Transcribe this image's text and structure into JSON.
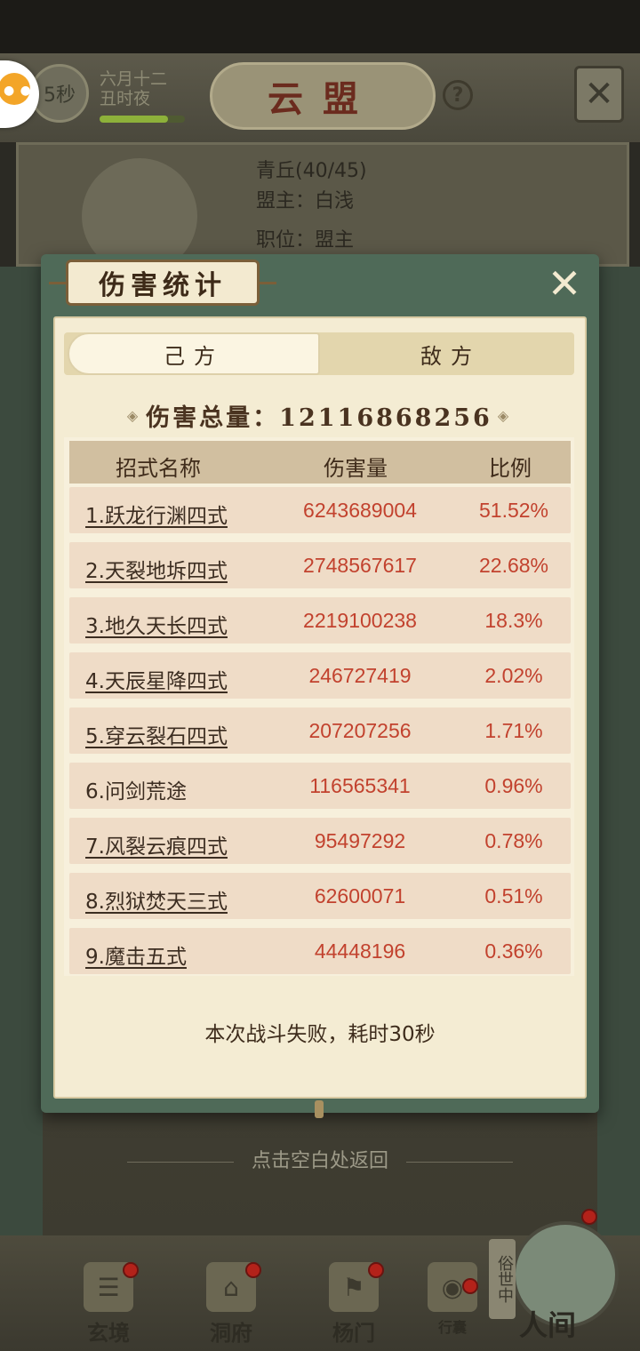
{
  "header": {
    "timer": "5秒",
    "date_line1": "六月十二",
    "date_line2": "丑时夜",
    "date_progress": 0.8,
    "title": "云盟",
    "help_label": "?"
  },
  "guild": {
    "name": "青丘(40/45)",
    "leader": "盟主：白浅",
    "position": "职位：盟主"
  },
  "dialog": {
    "title": "伤害统计",
    "tabs": [
      "己方",
      "敌方"
    ],
    "active_tab": "己方",
    "total_label": "伤害总量：12116868256",
    "columns": [
      "招式名称",
      "伤害量",
      "比例"
    ],
    "rows": [
      {
        "name": "1.跃龙行渊四式",
        "damage": "6243689004",
        "pct": "51.52%"
      },
      {
        "name": "2.天裂地坼四式",
        "damage": "2748567617",
        "pct": "22.68%"
      },
      {
        "name": "3.地久天长四式",
        "damage": "2219100238",
        "pct": "18.3%"
      },
      {
        "name": "4.天辰星降四式",
        "damage": "246727419",
        "pct": "2.02%"
      },
      {
        "name": "5.穿云裂石四式",
        "damage": "207207256",
        "pct": "1.71%"
      },
      {
        "name": "6.问剑荒途",
        "damage": "116565341",
        "pct": "0.96%"
      },
      {
        "name": "7.风裂云痕四式",
        "damage": "95497292",
        "pct": "0.78%"
      },
      {
        "name": "8.烈狱焚天三式",
        "damage": "62600071",
        "pct": "0.51%"
      },
      {
        "name": "9.魔击五式",
        "damage": "44448196",
        "pct": "0.36%"
      }
    ],
    "result": "本次战斗失败，耗时30秒"
  },
  "return_hint": "点击空白处返回",
  "nav": {
    "items": [
      "玄境",
      "洞府",
      "杨门",
      "行囊"
    ],
    "side_label": "俗世中",
    "human": "人间"
  },
  "colors": {
    "accent_red": "#c2422e",
    "dialog_frame": "#4f6a58",
    "parchment": "#f4ecd3"
  }
}
